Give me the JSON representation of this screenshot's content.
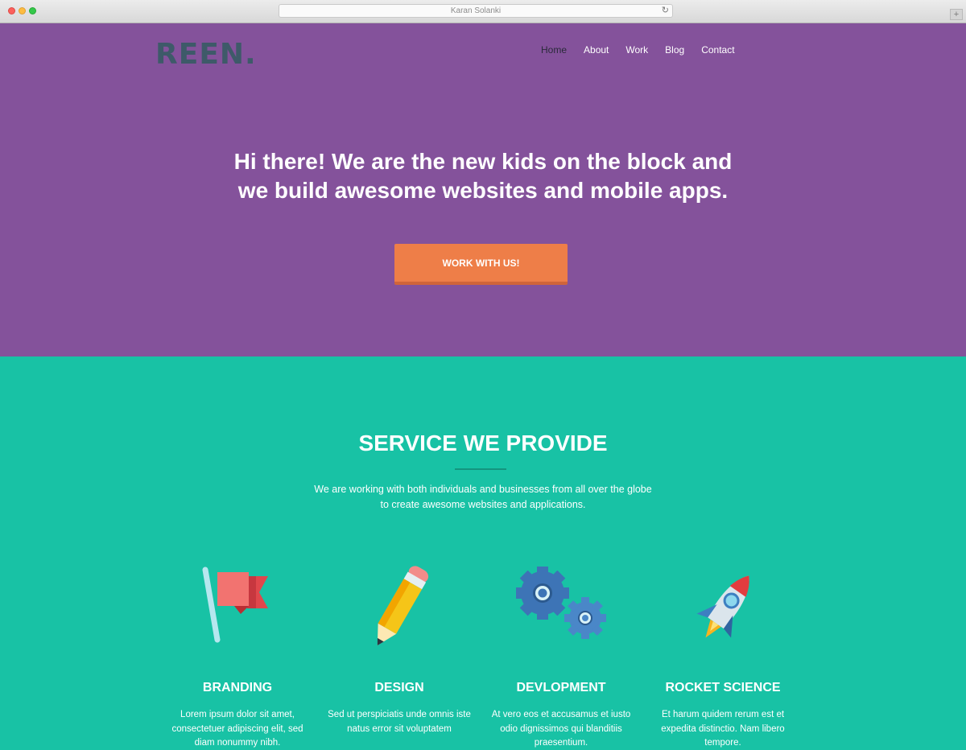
{
  "browser": {
    "url_title": "Karan Solanki",
    "reload_glyph": "↻",
    "newtab_glyph": "+"
  },
  "header": {
    "logo": "REEN.",
    "nav": [
      {
        "label": "Home",
        "active": true
      },
      {
        "label": "About",
        "active": false
      },
      {
        "label": "Work",
        "active": false
      },
      {
        "label": "Blog",
        "active": false
      },
      {
        "label": "Contact",
        "active": false
      }
    ]
  },
  "hero": {
    "headline_line1": "Hi there! We are the new kids on the block and",
    "headline_line2": "we build awesome websites and mobile apps.",
    "cta_label": "WORK WITH US!"
  },
  "services": {
    "title": "SERVICE WE PROVIDE",
    "desc_line1": "We are working with both individuals and businesses from all over the globe",
    "desc_line2": "to create awesome websites and applications.",
    "items": [
      {
        "icon": "flag-icon",
        "title": "BRANDING",
        "lines": [
          "Lorem ipsum dolor sit amet,",
          "consectetuer adipiscing elit, sed",
          "diam nonummy nibh."
        ]
      },
      {
        "icon": "pencil-icon",
        "title": "DESIGN",
        "lines": [
          "Sed ut perspiciatis unde omnis iste",
          "natus error sit voluptatem"
        ]
      },
      {
        "icon": "gears-icon",
        "title": "DEVLOPMENT",
        "lines": [
          "At vero eos et accusamus et iusto",
          "odio dignissimos qui blanditiis",
          "praesentium."
        ]
      },
      {
        "icon": "rocket-icon",
        "title": "ROCKET SCIENCE",
        "lines": [
          "Et harum quidem rerum est et",
          "expedita distinctio. Nam libero",
          "tempore."
        ]
      }
    ]
  },
  "colors": {
    "hero_bg": "#84529b",
    "services_bg": "#18c2a5",
    "cta": "#ee7e48",
    "logo": "#3e5a69"
  }
}
